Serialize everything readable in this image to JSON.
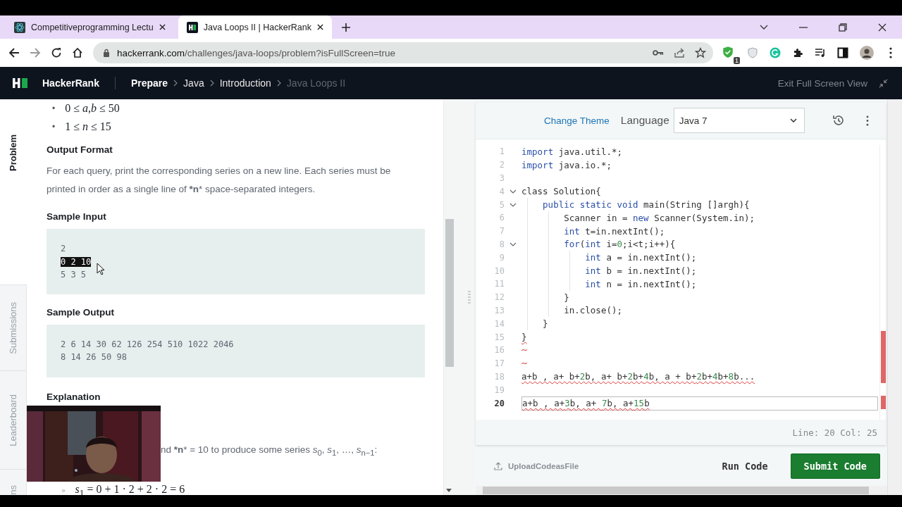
{
  "browser": {
    "tabs": [
      {
        "title": "Competitiveprogramming Lectu",
        "selected": false
      },
      {
        "title": "Java Loops II | HackerRank",
        "selected": true
      }
    ],
    "url_host": "hackerrank.com",
    "url_path": "/challenges/java-loops/problem?isFullScreen=true",
    "extension_badge": "1"
  },
  "nav": {
    "brand": "HackerRank",
    "breadcrumb": [
      {
        "label": "Prepare",
        "current": false,
        "bold": true
      },
      {
        "label": "Java",
        "current": false,
        "bold": false
      },
      {
        "label": "Introduction",
        "current": false,
        "bold": false
      },
      {
        "label": "Java Loops II",
        "current": true,
        "bold": false
      }
    ],
    "exit": "Exit Full Screen View"
  },
  "side_tabs": [
    {
      "label": "Problem",
      "selected": true
    },
    {
      "label": "Submissions",
      "selected": false
    },
    {
      "label": "Leaderboard",
      "selected": false
    },
    {
      "label": "ns",
      "selected": false
    }
  ],
  "problem": {
    "constraints": [
      {
        "marker": "•",
        "text": "0 ≤ *a*,*b* ≤ 50"
      },
      {
        "marker": "•",
        "text": "1 ≤ *n* ≤ 15"
      }
    ],
    "output_heading": "Output Format",
    "output_text": "For each query, print the corresponding series on a new line. Each series must be printed in order as a single line of ***n*** space-separated integers.",
    "input_heading": "Sample Input",
    "input_lines": [
      {
        "text": "2",
        "selected": false
      },
      {
        "text": "0 2 10",
        "selected": true
      },
      {
        "text": "5 3 5",
        "selected": false
      }
    ],
    "output_sample_heading": "Sample Output",
    "output_lines": [
      "2 6 14 30 62 126 254 510 1022 2046",
      "8 14 26 50 98"
    ],
    "explanation_heading": "Explanation",
    "explanation_text": "nd ***n*** = 10 to produce some series *s*$_{0}$, *s*$_{1}$, …, *s*$_{n−1}$:",
    "series_item": {
      "marker": "◦",
      "text": "*s*$_{1}$ = 0 + 1 · 2 + 2 · 2 = 6"
    },
    "overlay": {
      "kind": "picture"
    }
  },
  "editor": {
    "change_theme": "Change Theme",
    "language_label": "Language",
    "language": "Java 7",
    "lines": [
      {
        "number": "1",
        "fold": false,
        "active": false,
        "error": false,
        "segments": [
          {
            "kind": "kw",
            "text": "import"
          },
          {
            "kind": "text",
            "text": " java.util.*;"
          }
        ]
      },
      {
        "number": "2",
        "fold": false,
        "active": false,
        "error": false,
        "segments": [
          {
            "kind": "kw",
            "text": "import"
          },
          {
            "kind": "text",
            "text": " java.io.*;"
          }
        ]
      },
      {
        "number": "3",
        "fold": false,
        "active": false,
        "error": false
      },
      {
        "number": "4",
        "fold": true,
        "active": false,
        "error": false,
        "segments": [
          {
            "kind": "text",
            "text": "class Solution{"
          }
        ],
        "children": [
          {
            "number": "5",
            "fold": true,
            "active": false,
            "error": false,
            "segments": [
              {
                "kind": "kw",
                "text": "public static void"
              },
              {
                "kind": "text",
                "text": " main(String []argh){"
              }
            ],
            "children": [
              {
                "number": "6",
                "fold": false,
                "active": false,
                "error": false,
                "segments": [
                  {
                    "kind": "text",
                    "text": "Scanner in = "
                  },
                  {
                    "kind": "kw",
                    "text": "new"
                  },
                  {
                    "kind": "text",
                    "text": " Scanner(System.in);"
                  }
                ]
              },
              {
                "number": "7",
                "fold": false,
                "active": false,
                "error": false,
                "segments": [
                  {
                    "kind": "kw",
                    "text": "int"
                  },
                  {
                    "kind": "text",
                    "text": " t=in.nextInt();"
                  }
                ]
              },
              {
                "number": "8",
                "fold": true,
                "active": false,
                "error": false,
                "segments": [
                  {
                    "kind": "kw",
                    "text": "for"
                  },
                  {
                    "kind": "text",
                    "text": "("
                  },
                  {
                    "kind": "kw",
                    "text": "int"
                  },
                  {
                    "kind": "text",
                    "text": " i="
                  },
                  {
                    "kind": "num",
                    "text": "0"
                  },
                  {
                    "kind": "text",
                    "text": ";i<t;i++){"
                  }
                ],
                "children": [
                  {
                    "number": "9",
                    "fold": false,
                    "active": false,
                    "error": false,
                    "segments": [
                      {
                        "kind": "kw",
                        "text": "int"
                      },
                      {
                        "kind": "text",
                        "text": " a = in.nextInt();"
                      }
                    ]
                  },
                  {
                    "number": "10",
                    "fold": false,
                    "active": false,
                    "error": false,
                    "segments": [
                      {
                        "kind": "kw",
                        "text": "int"
                      },
                      {
                        "kind": "text",
                        "text": " b = in.nextInt();"
                      }
                    ]
                  },
                  {
                    "number": "11",
                    "fold": false,
                    "active": false,
                    "error": false,
                    "segments": [
                      {
                        "kind": "kw",
                        "text": "int"
                      },
                      {
                        "kind": "text",
                        "text": " n = in.nextInt();"
                      }
                    ]
                  }
                ]
              },
              {
                "number": "12",
                "fold": false,
                "active": false,
                "error": false,
                "segments": [
                  {
                    "kind": "text",
                    "text": "}"
                  }
                ]
              },
              {
                "number": "13",
                "fold": false,
                "active": false,
                "error": false,
                "segments": [
                  {
                    "kind": "text",
                    "text": "in.close();"
                  }
                ]
              }
            ]
          },
          {
            "number": "14",
            "fold": false,
            "active": false,
            "error": false,
            "segments": [
              {
                "kind": "text",
                "text": "}"
              }
            ]
          }
        ]
      },
      {
        "number": "15",
        "fold": false,
        "active": false,
        "error": true,
        "segments": [
          {
            "kind": "text",
            "text": "}"
          }
        ]
      },
      {
        "number": "16",
        "fold": false,
        "active": false,
        "error": true
      },
      {
        "number": "17",
        "fold": false,
        "active": false,
        "error": true
      },
      {
        "number": "18",
        "fold": false,
        "active": false,
        "error": true,
        "segments": [
          {
            "kind": "text",
            "text": "a+b , a+ b+"
          },
          {
            "kind": "num",
            "text": "2"
          },
          {
            "kind": "text",
            "text": "b, a+ b+"
          },
          {
            "kind": "num",
            "text": "2"
          },
          {
            "kind": "text",
            "text": "b+"
          },
          {
            "kind": "num",
            "text": "4"
          },
          {
            "kind": "text",
            "text": "b, a + b+"
          },
          {
            "kind": "num",
            "text": "2"
          },
          {
            "kind": "text",
            "text": "b+"
          },
          {
            "kind": "num",
            "text": "4"
          },
          {
            "kind": "text",
            "text": "b+"
          },
          {
            "kind": "num",
            "text": "8"
          },
          {
            "kind": "text",
            "text": "b..."
          }
        ]
      },
      {
        "number": "19",
        "fold": false,
        "active": false,
        "error": false
      },
      {
        "number": "20",
        "fold": false,
        "active": true,
        "error": true,
        "segments": [
          {
            "kind": "text",
            "text": "a+b , a+"
          },
          {
            "kind": "num",
            "text": "3"
          },
          {
            "kind": "text",
            "text": "b, a+ "
          },
          {
            "kind": "num",
            "text": "7"
          },
          {
            "kind": "text",
            "text": "b, a+"
          },
          {
            "kind": "num",
            "text": "15"
          },
          {
            "kind": "text",
            "text": "b"
          }
        ]
      }
    ],
    "status": "Line: 20 Col: 25",
    "upload": "UploadCodeasFile",
    "run": "Run Code",
    "submit": "Submit Code"
  }
}
